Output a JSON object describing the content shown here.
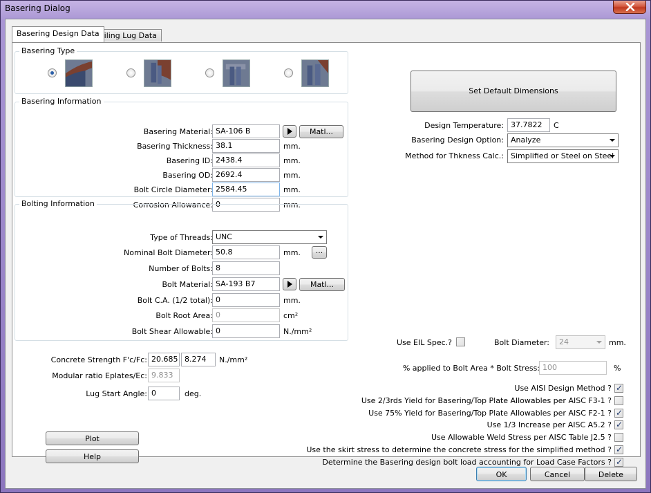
{
  "window": {
    "title": "Basering Dialog"
  },
  "tabs": [
    {
      "label": "Basering Design Data"
    },
    {
      "label": "Tailing Lug Data"
    }
  ],
  "basering_type": {
    "label": "Basering Type",
    "selected_index": 0
  },
  "basering_info": {
    "label": "Basering Information",
    "material_label": "Basering Material:",
    "material_value": "SA-106 B",
    "matl_button": "Matl...",
    "thickness_label": "Basering Thickness:",
    "thickness_value": "38.1",
    "thickness_unit": "mm.",
    "id_label": "Basering ID:",
    "id_value": "2438.4",
    "id_unit": "mm.",
    "od_label": "Basering OD:",
    "od_value": "2692.4",
    "od_unit": "mm.",
    "bcd_label": "Bolt Circle Diameter:",
    "bcd_value": "2584.45",
    "bcd_unit": "mm.",
    "ca_label": "Corrosion Allowance:",
    "ca_value": "0",
    "ca_unit": "mm."
  },
  "bolting_info": {
    "label": "Bolting Information",
    "threads_label": "Type of Threads:",
    "threads_value": "UNC",
    "nominal_label": "Nominal Bolt Diameter:",
    "nominal_value": "50.8",
    "nominal_unit": "mm.",
    "nominal_button": "...",
    "count_label": "Number of Bolts:",
    "count_value": "8",
    "material_label": "Bolt Material:",
    "material_value": "SA-193 B7",
    "matl_button": "Matl...",
    "ca_label": "Bolt C.A. (1/2 total):",
    "ca_value": "0",
    "ca_unit": "mm.",
    "root_label": "Bolt Root Area:",
    "root_value": "0",
    "root_unit": "cm²",
    "shear_label": "Bolt Shear Allowable:",
    "shear_value": "0",
    "shear_unit": "N./mm²"
  },
  "concrete": {
    "strength_label": "Concrete Strength F'c/Fc:",
    "fc1": "20.685",
    "fc2": "8.274",
    "unit": "N./mm²",
    "modular_label": "Modular ratio Eplates/Ec:",
    "modular_value": "9.833",
    "lug_label": "Lug Start Angle:",
    "lug_value": "0",
    "lug_unit": "deg."
  },
  "buttons": {
    "plot": "Plot",
    "help": "Help",
    "set_default": "Set Default Dimensions",
    "ok": "OK",
    "cancel": "Cancel",
    "delete": "Delete"
  },
  "design": {
    "temp_label": "Design Temperature:",
    "temp_value": "37.7822",
    "temp_unit": "C",
    "option_label": "Basering Design Option:",
    "option_value": "Analyze",
    "method_label": "Method for Thkness Calc.:",
    "method_value": "Simplified or Steel on Steel"
  },
  "eil": {
    "label": "Use EIL Spec.?",
    "checked": false,
    "bolt_dia_label": "Bolt Diameter:",
    "bolt_dia_value": "24",
    "bolt_dia_unit": "mm.",
    "pct_label": "% applied to Bolt Area * Bolt Stress:",
    "pct_value": "100",
    "pct_unit": "%"
  },
  "options": [
    {
      "label": "Use AISI Design Method ?",
      "checked": true
    },
    {
      "label": "Use 2/3rds Yield for Basering/Top Plate Allowables per AISC F3-1 ?",
      "checked": false
    },
    {
      "label": "Use 75% Yield for Basering/Top Plate Allowables per AISC F2-1 ?",
      "checked": true
    },
    {
      "label": "Use 1/3 Increase per AISC A5.2 ?",
      "checked": true
    },
    {
      "label": "Use Allowable Weld Stress per AISC Table J2.5 ?",
      "checked": false
    },
    {
      "label": "Use the skirt stress to determine the concrete stress for the simplified method ?",
      "checked": true
    },
    {
      "label": "Determine the Basering design bolt load accounting for Load Case Factors ?",
      "checked": true
    }
  ],
  "check_mark": "✓"
}
